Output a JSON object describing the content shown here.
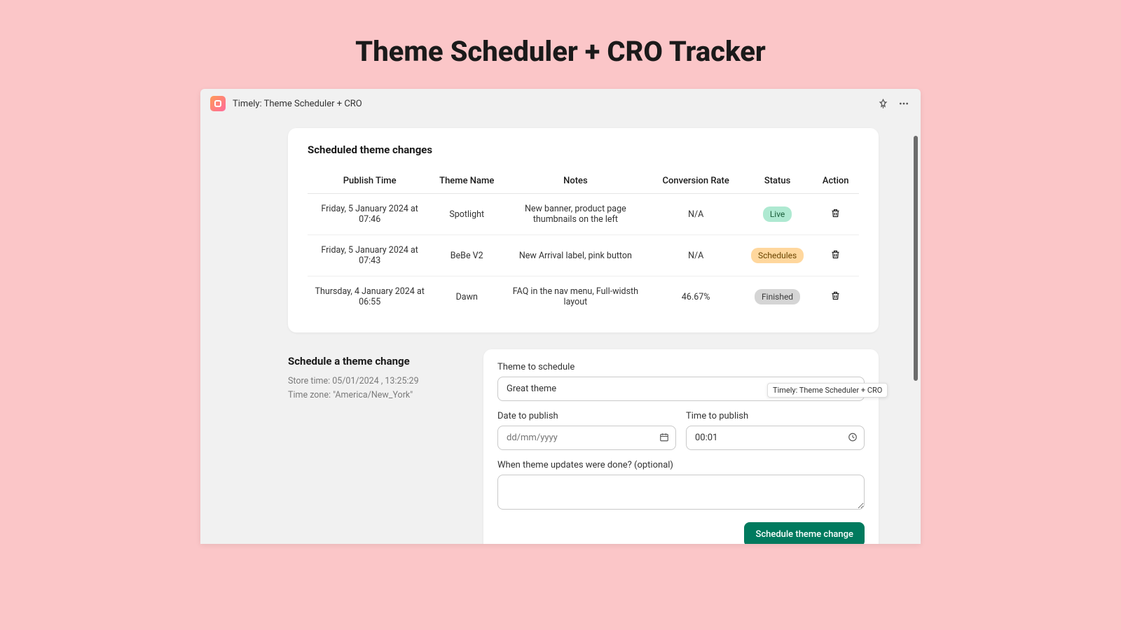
{
  "hero": {
    "title": "Theme Scheduler + CRO Tracker"
  },
  "header": {
    "app_name": "Timely: Theme Scheduler + CRO"
  },
  "table_card": {
    "title": "Scheduled theme changes",
    "columns": {
      "publish_time": "Publish Time",
      "theme_name": "Theme Name",
      "notes": "Notes",
      "conversion_rate": "Conversion Rate",
      "status": "Status",
      "action": "Action"
    },
    "rows": [
      {
        "publish_time": "Friday, 5 January 2024 at 07:46",
        "theme": "Spotlight",
        "notes": "New banner, product page thumbnails on the left",
        "rate": "N/A",
        "status": "Live",
        "status_kind": "live"
      },
      {
        "publish_time": "Friday, 5 January 2024 at 07:43",
        "theme": "BeBe V2",
        "notes": "New Arrival label, pink button",
        "rate": "N/A",
        "status": "Schedules",
        "status_kind": "schedules"
      },
      {
        "publish_time": "Thursday, 4 January 2024 at 06:55",
        "theme": "Dawn",
        "notes": "FAQ in the nav menu, Full-widsth layout",
        "rate": "46.67%",
        "status": "Finished",
        "status_kind": "finished"
      }
    ]
  },
  "schedule": {
    "title": "Schedule a theme change",
    "store_time": "Store time: 05/01/2024 , 13:25:29",
    "timezone": "Time zone: \"America/New_York\"",
    "labels": {
      "theme": "Theme to schedule",
      "date": "Date to publish",
      "time": "Time to publish",
      "notes": "When theme updates were done? (optional)"
    },
    "values": {
      "theme": "Great theme",
      "date_placeholder": "dd/mm/yyyy",
      "time": "00:01"
    },
    "submit": "Schedule theme change"
  },
  "tooltip": "Timely: Theme Scheduler + CRO"
}
